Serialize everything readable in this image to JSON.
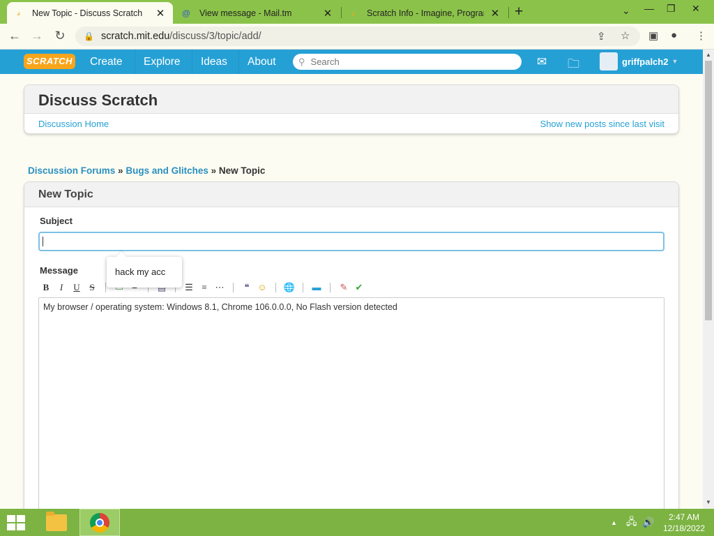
{
  "browser": {
    "tabs": [
      {
        "title": "New Topic - Discuss Scratch",
        "active": true
      },
      {
        "title": "View message - Mail.tm",
        "active": false
      },
      {
        "title": "Scratch Info - Imagine, Program,",
        "active": false
      }
    ],
    "url_host": "scratch.mit.edu",
    "url_path": "/discuss/3/topic/add/"
  },
  "scratch_nav": {
    "logo": "SCRATCH",
    "items": [
      "Create",
      "Explore",
      "Ideas",
      "About"
    ],
    "search_placeholder": "Search",
    "username": "griffpalch2"
  },
  "discuss": {
    "title": "Discuss Scratch",
    "home_link": "Discussion Home",
    "new_posts_link": "Show new posts since last visit"
  },
  "breadcrumb": {
    "forums": "Discussion Forums",
    "sep": "»",
    "category": "Bugs and Glitches",
    "current": "New Topic"
  },
  "form": {
    "title": "New Topic",
    "subject_label": "Subject",
    "subject_value": "",
    "message_label": "Message",
    "message_value": "My browser / operating system: Windows 8.1, Chrome 106.0.0.0, No Flash version detected",
    "autocomplete_suggestion": "hack my acc"
  },
  "taskbar": {
    "time": "2:47 AM",
    "date": "12/18/2022"
  }
}
